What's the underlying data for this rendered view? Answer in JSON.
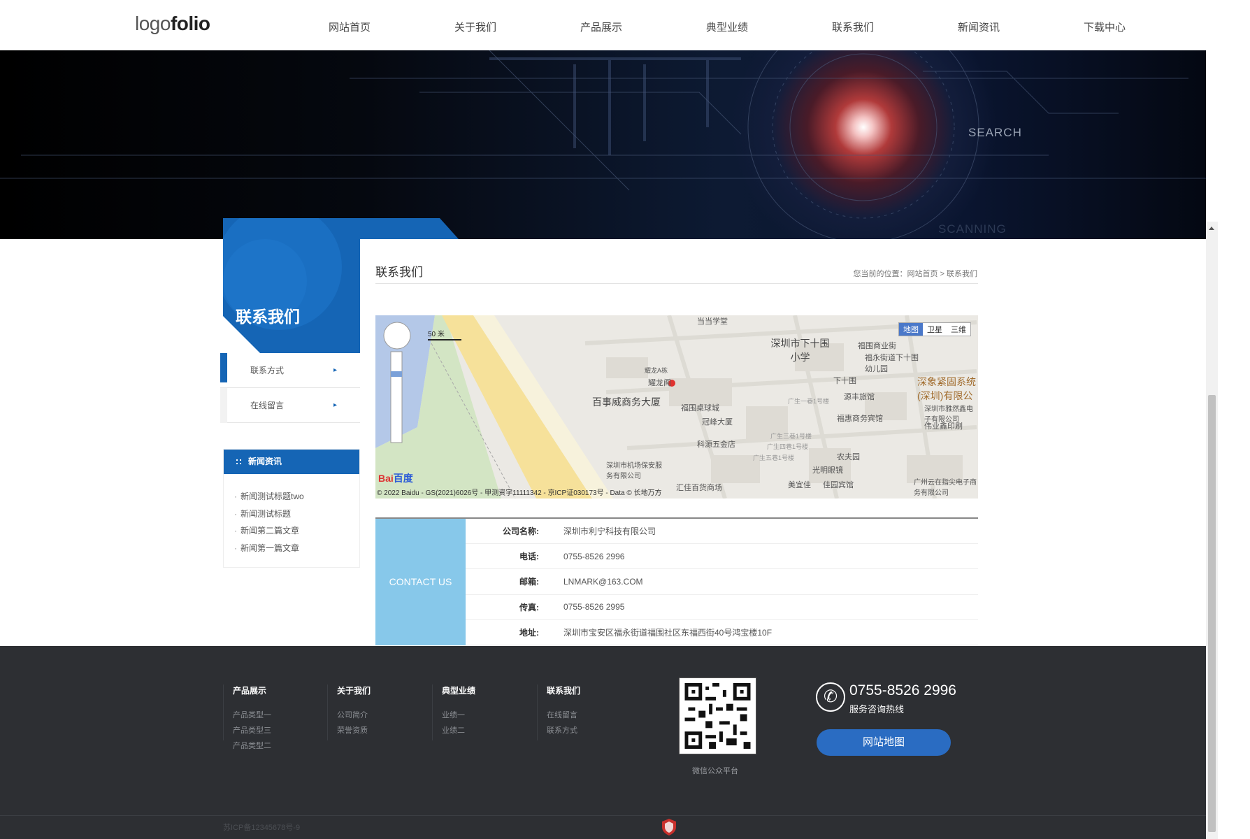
{
  "header": {
    "logo_light": "logo",
    "logo_bold": "folio",
    "nav": [
      "网站首页",
      "关于我们",
      "产品展示",
      "典型业绩",
      "联系我们",
      "新闻资讯",
      "下载中心"
    ]
  },
  "banner": {
    "search_text": "SEARCH",
    "scanning_text": "SCANNING"
  },
  "sidebar": {
    "title": "联系我们",
    "menu": [
      "联系方式",
      "在线留言"
    ],
    "arrow": "▸",
    "news_title": "新闻资讯",
    "news": [
      "新闻测试标题two",
      "新闻测试标题",
      "新闻第二篇文章",
      "新闻第一篇文章"
    ]
  },
  "main": {
    "title": "联系我们",
    "breadcrumb": "您当前的位置：网站首页 > 联系我们"
  },
  "map": {
    "types": [
      "地图",
      "卫星",
      "三维"
    ],
    "scale": "50 米",
    "copyright": "© 2022 Baidu - GS(2021)6026号 - 甲测资字11111342 - 京ICP证030173号 - Data © 长地万方",
    "logo_a": "Bai",
    "logo_b": "百度",
    "labels": {
      "l1": "当当学堂",
      "l2": "深圳市下十围小学",
      "l3": "福围商业街",
      "l4": "福永街道下十围幼儿园",
      "l5": "耀龙A栋",
      "l6": "耀龙阁",
      "l7": "百事威商务大厦",
      "l8": "福围桌球城",
      "l9": "冠峰大厦",
      "l10": "下十围",
      "l11": "源丰旅馆",
      "l12": "深象紧固系统(深圳)有限公",
      "l13": "福惠商务宾馆",
      "l14": "深圳市雅然鑫电子有限公司",
      "l15": "伟业鑫印刷",
      "l16": "科源五金店",
      "l17": "农夫园",
      "l18": "光明眼镜",
      "l19": "深圳市机场保安服务有限公司",
      "l20": "汇佳百货商场",
      "l21": "美宜佳",
      "l22": "佳园宾馆",
      "l23": "广州云在指尖电子商务有限公司",
      "l24": "广生一巷1号楼",
      "l25": "广生三巷1号楼",
      "l26": "广生四巷1号楼",
      "l27": "广生五巷1号楼"
    }
  },
  "contact": {
    "label": "CONTACT US",
    "rows": [
      {
        "k": "公司名称:",
        "v": "深圳市利宁科技有限公司"
      },
      {
        "k": "电话:",
        "v": "0755-8526 2996"
      },
      {
        "k": "邮箱:",
        "v": "LNMARK@163.COM"
      },
      {
        "k": "传真:",
        "v": "0755-8526 2995"
      },
      {
        "k": "地址:",
        "v": "深圳市宝安区福永街道福围社区东福西街40号鸿宝楼10F"
      }
    ]
  },
  "footer": {
    "cols": [
      {
        "title": "产品展示",
        "links": [
          "产品类型一",
          "产品类型三",
          "产品类型二"
        ]
      },
      {
        "title": "关于我们",
        "links": [
          "公司简介",
          "荣誉资质"
        ]
      },
      {
        "title": "典型业绩",
        "links": [
          "业绩一",
          "业绩二"
        ]
      },
      {
        "title": "联系我们",
        "links": [
          "在线留言",
          "联系方式"
        ]
      }
    ],
    "qr_caption": "微信公众平台",
    "phone": "0755-8526 2996",
    "phone_sub": "服务咨询热线",
    "sitemap": "网站地图",
    "icp": "苏ICP备12345678号-9"
  },
  "colors": {
    "brand": "#1565b5",
    "contact_bg": "#87c8ea",
    "footer_bg": "#2d2f33",
    "button": "#2a6cc2"
  }
}
